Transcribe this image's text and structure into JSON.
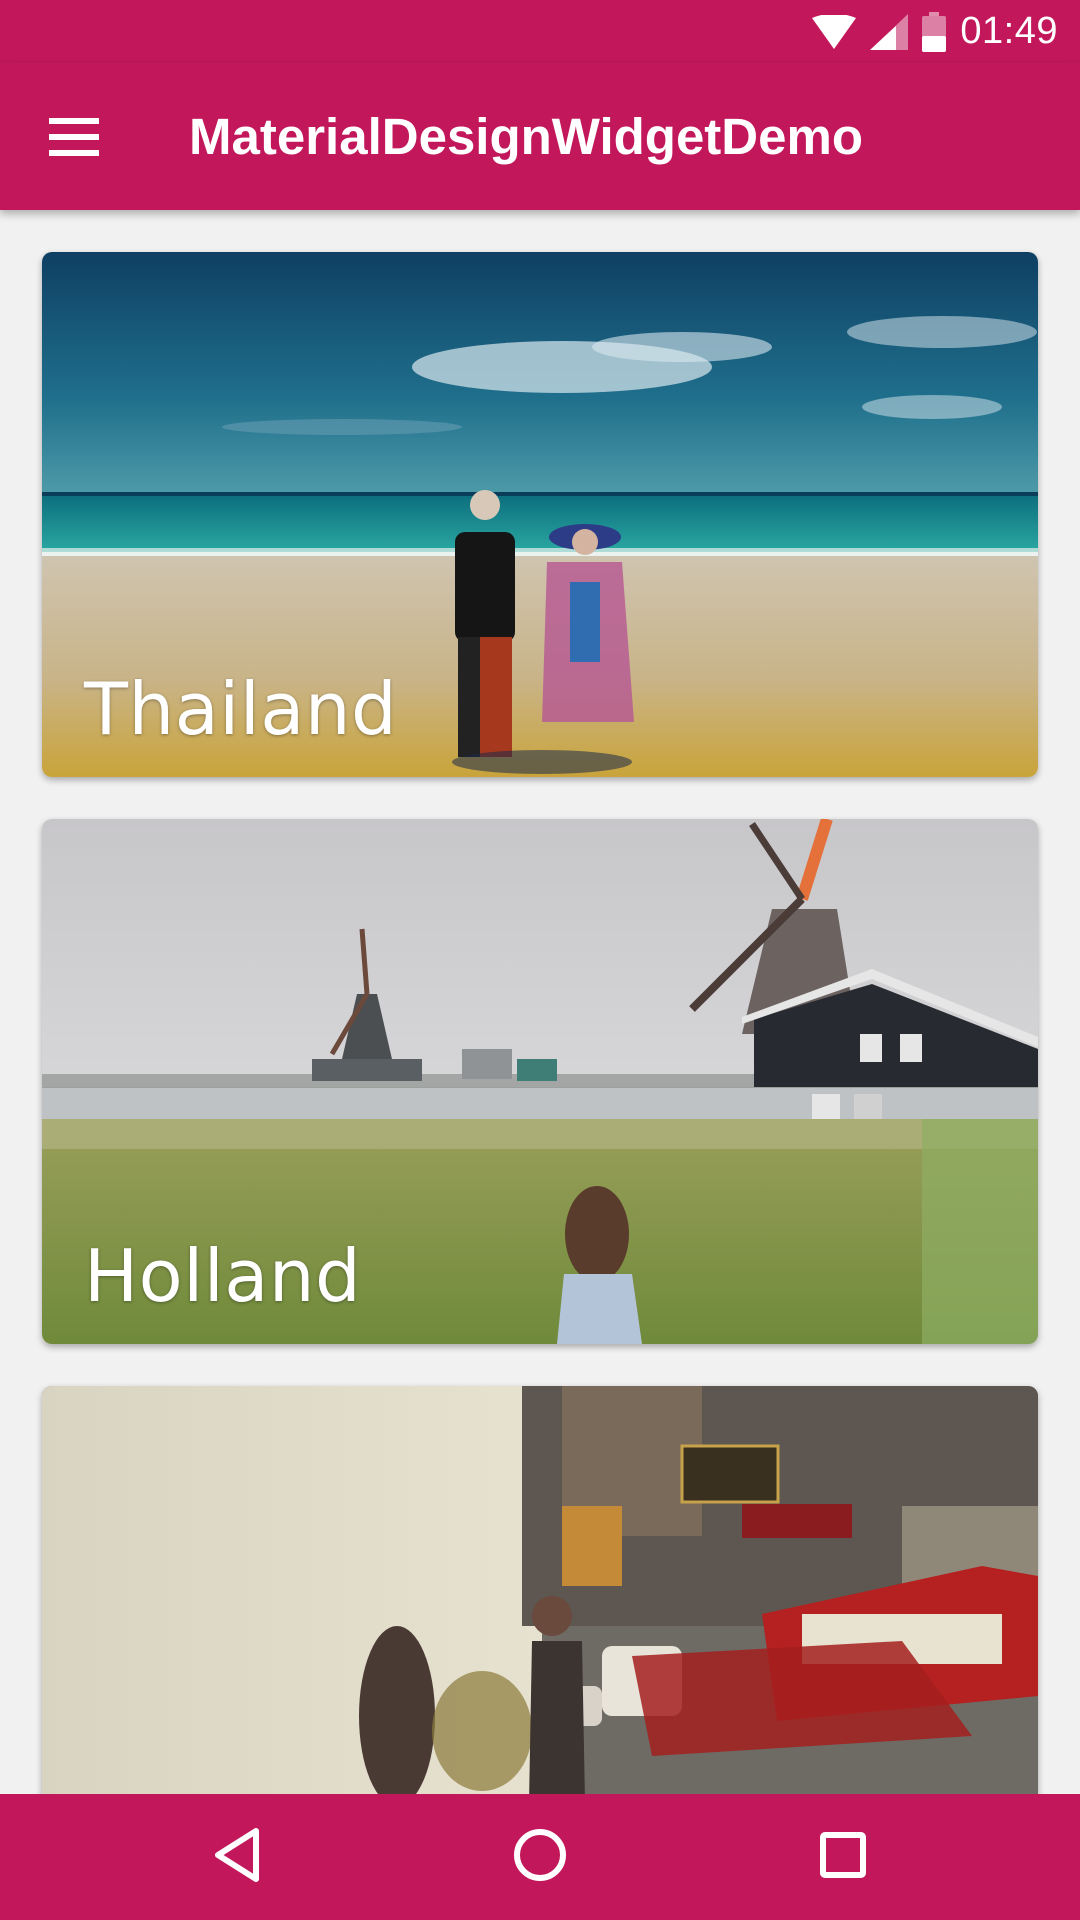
{
  "status_bar": {
    "time": "01:49",
    "icons": [
      "wifi-icon",
      "cellular-signal-icon",
      "battery-low-icon"
    ]
  },
  "app_bar": {
    "title": "MaterialDesignWidgetDemo",
    "menu_icon": "hamburger-menu-icon"
  },
  "cards": [
    {
      "title": "Thailand"
    },
    {
      "title": "Holland"
    },
    {
      "title": ""
    }
  ],
  "nav_bar": {
    "icons": [
      "back-triangle-icon",
      "home-circle-icon",
      "recents-square-icon"
    ]
  },
  "colors": {
    "primary": "#c2185b",
    "background": "#f1f1f1",
    "on_primary": "#ffffff"
  }
}
